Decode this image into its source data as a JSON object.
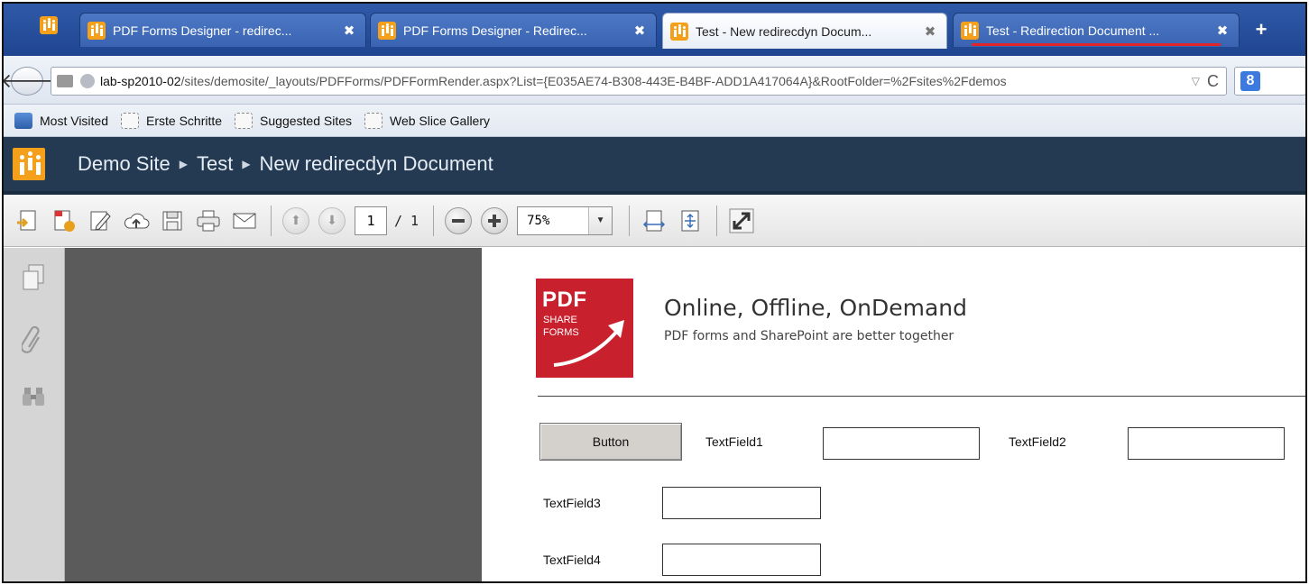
{
  "tabs": [
    {
      "title": "PDF Forms Designer - redirec...",
      "close": "✖",
      "active": false
    },
    {
      "title": "PDF Forms Designer - Redirec...",
      "close": "✖",
      "active": false
    },
    {
      "title": "Test - New redirecdyn Docum...",
      "close": "✖",
      "active": true
    },
    {
      "title": "Test - Redirection Document ...",
      "close": "✖",
      "active": false
    }
  ],
  "new_tab": "+",
  "address": {
    "host": "lab-sp2010-02",
    "path": "/sites/demosite/_layouts/PDFForms/PDFFormRender.aspx?List={E035AE74-B308-443E-B4BF-ADD1A417064A}&RootFolder=%2Fsites%2Fdemos",
    "dropdown": "▽",
    "reload": "C"
  },
  "search": {
    "engine_letter": "8"
  },
  "bookmarks": [
    {
      "label": "Most Visited",
      "icon": "most-visited-icon"
    },
    {
      "label": "Erste Schritte",
      "icon": "page-icon"
    },
    {
      "label": "Suggested Sites",
      "icon": "page-icon"
    },
    {
      "label": "Web Slice Gallery",
      "icon": "page-icon"
    }
  ],
  "breadcrumb": {
    "items": [
      "Demo Site",
      "Test",
      "New redirecdyn Document"
    ],
    "separator": "▶"
  },
  "viewer": {
    "page_current": "1",
    "page_total": "/ 1",
    "zoom": "75%"
  },
  "pdf": {
    "logo": {
      "line1": "PDF",
      "line2": "SHARE",
      "line3": "FORMS"
    },
    "tagline": "Online, Offline, OnDemand",
    "subline": "PDF forms and SharePoint are better together",
    "button_label": "Button",
    "fields": [
      {
        "label": "TextField1",
        "value": ""
      },
      {
        "label": "TextField2",
        "value": ""
      },
      {
        "label": "TextField3",
        "value": ""
      },
      {
        "label": "TextField4",
        "value": ""
      }
    ]
  },
  "colors": {
    "tabbar": "#2f5aa8",
    "sp_header": "#243a52",
    "logo_red": "#c8202d",
    "app_orange": "#f4a01b"
  }
}
